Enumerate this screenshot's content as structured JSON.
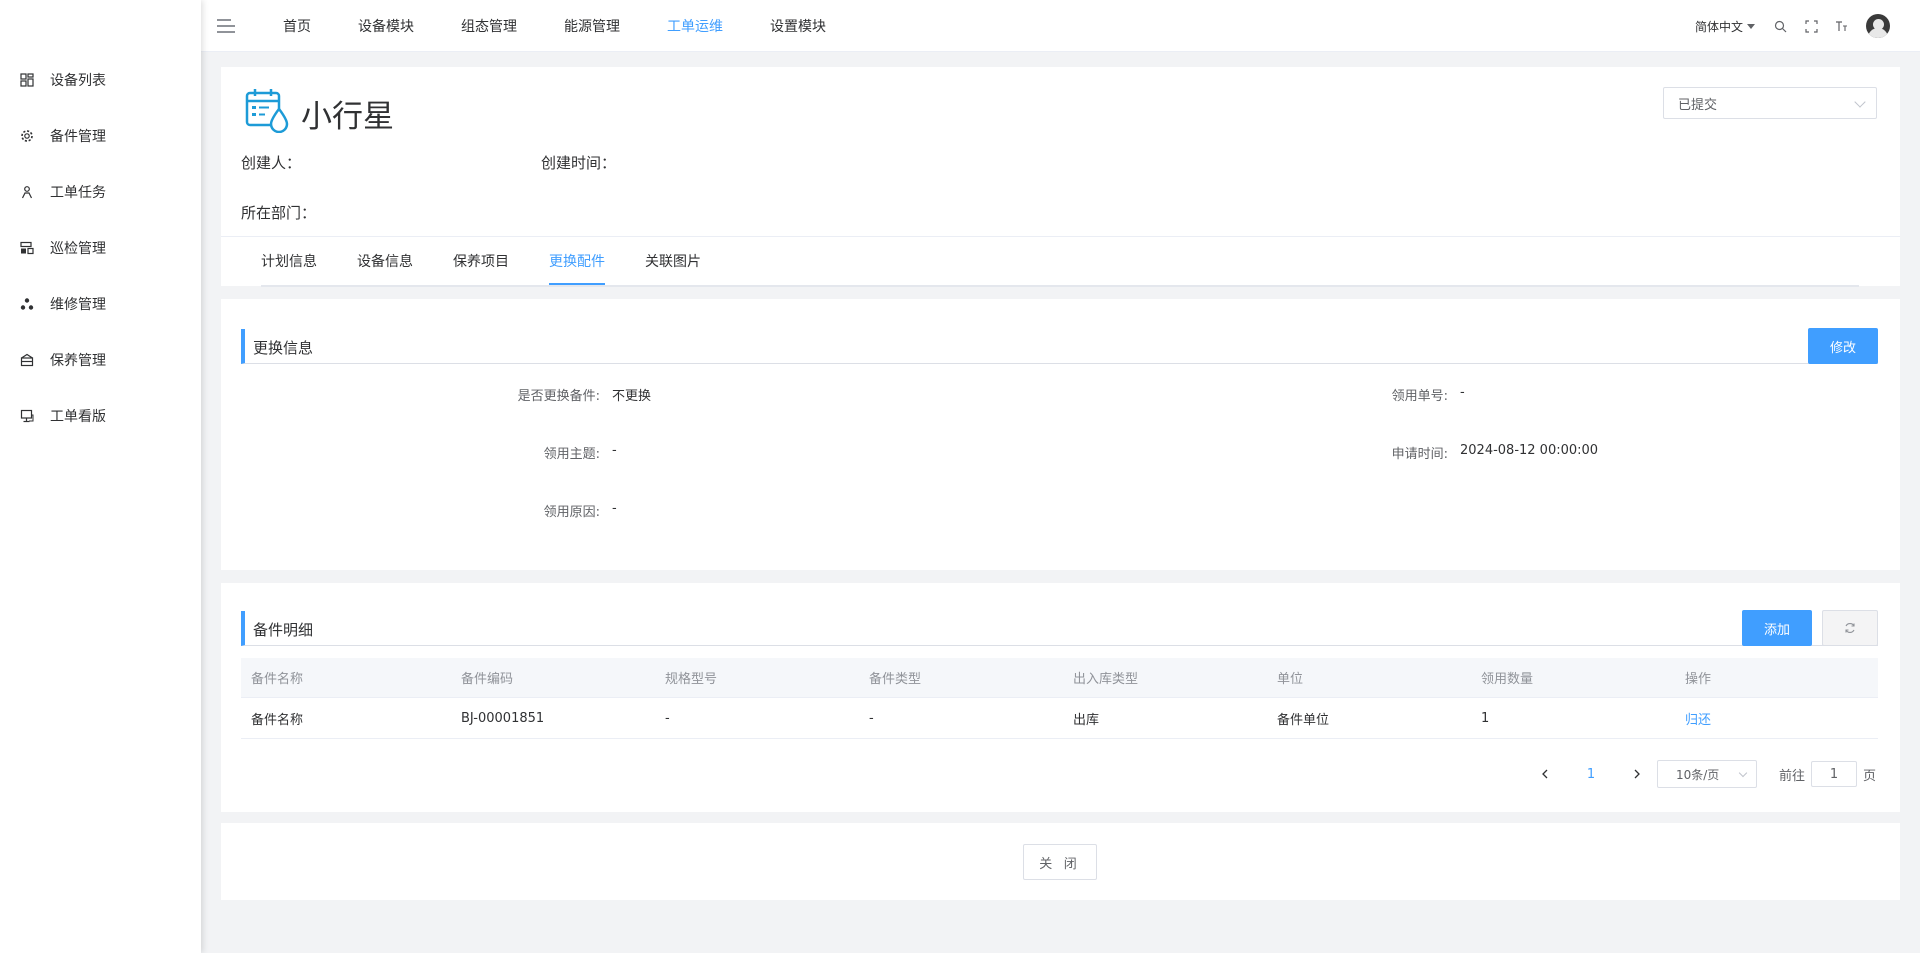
{
  "sidebar": {
    "items": [
      {
        "label": "设备列表",
        "icon": "grid-icon"
      },
      {
        "label": "备件管理",
        "icon": "gear-icon"
      },
      {
        "label": "工单任务",
        "icon": "person-icon"
      },
      {
        "label": "巡检管理",
        "icon": "inspection-icon"
      },
      {
        "label": "维修管理",
        "icon": "cluster-icon"
      },
      {
        "label": "保养管理",
        "icon": "toolbox-icon"
      },
      {
        "label": "工单看版",
        "icon": "monitor-icon"
      }
    ]
  },
  "topbar": {
    "nav": [
      "首页",
      "设备模块",
      "组态管理",
      "能源管理",
      "工单运维",
      "设置模块"
    ],
    "active_nav": "工单运维",
    "language": "简体中文"
  },
  "header": {
    "title": "小行星",
    "status": "已提交",
    "creator_label": "创建人：",
    "created_time_label": "创建时间：",
    "department_label": "所在部门：",
    "tabs": [
      "计划信息",
      "设备信息",
      "保养项目",
      "更换配件",
      "关联图片"
    ],
    "active_tab": "更换配件"
  },
  "replace_info": {
    "title": "更换信息",
    "edit_label": "修改",
    "fields": {
      "replace_parts": {
        "label": "是否更换备件:",
        "value": "不更换"
      },
      "claim_no": {
        "label": "领用单号:",
        "value": "-"
      },
      "claim_subject": {
        "label": "领用主题:",
        "value": "-"
      },
      "apply_time": {
        "label": "申请时间:",
        "value": "2024-08-12 00:00:00"
      },
      "claim_reason": {
        "label": "领用原因:",
        "value": "-"
      }
    }
  },
  "parts_detail": {
    "title": "备件明细",
    "add_label": "添加",
    "columns": [
      "备件名称",
      "备件编码",
      "规格型号",
      "备件类型",
      "出入库类型",
      "单位",
      "领用数量",
      "操作"
    ],
    "rows": [
      [
        "备件名称",
        "BJ-00001851",
        "-",
        "-",
        "出库",
        "备件单位",
        "1",
        "归还"
      ]
    ],
    "pagination": {
      "current": "1",
      "page_size": "10条/页",
      "goto_prefix": "前往",
      "goto_value": "1",
      "goto_suffix": "页"
    }
  },
  "footer": {
    "close_label": "关 闭"
  },
  "colors": {
    "primary": "#409eff",
    "text": "#303133",
    "muted": "#909399",
    "background": "#f2f3f5"
  }
}
